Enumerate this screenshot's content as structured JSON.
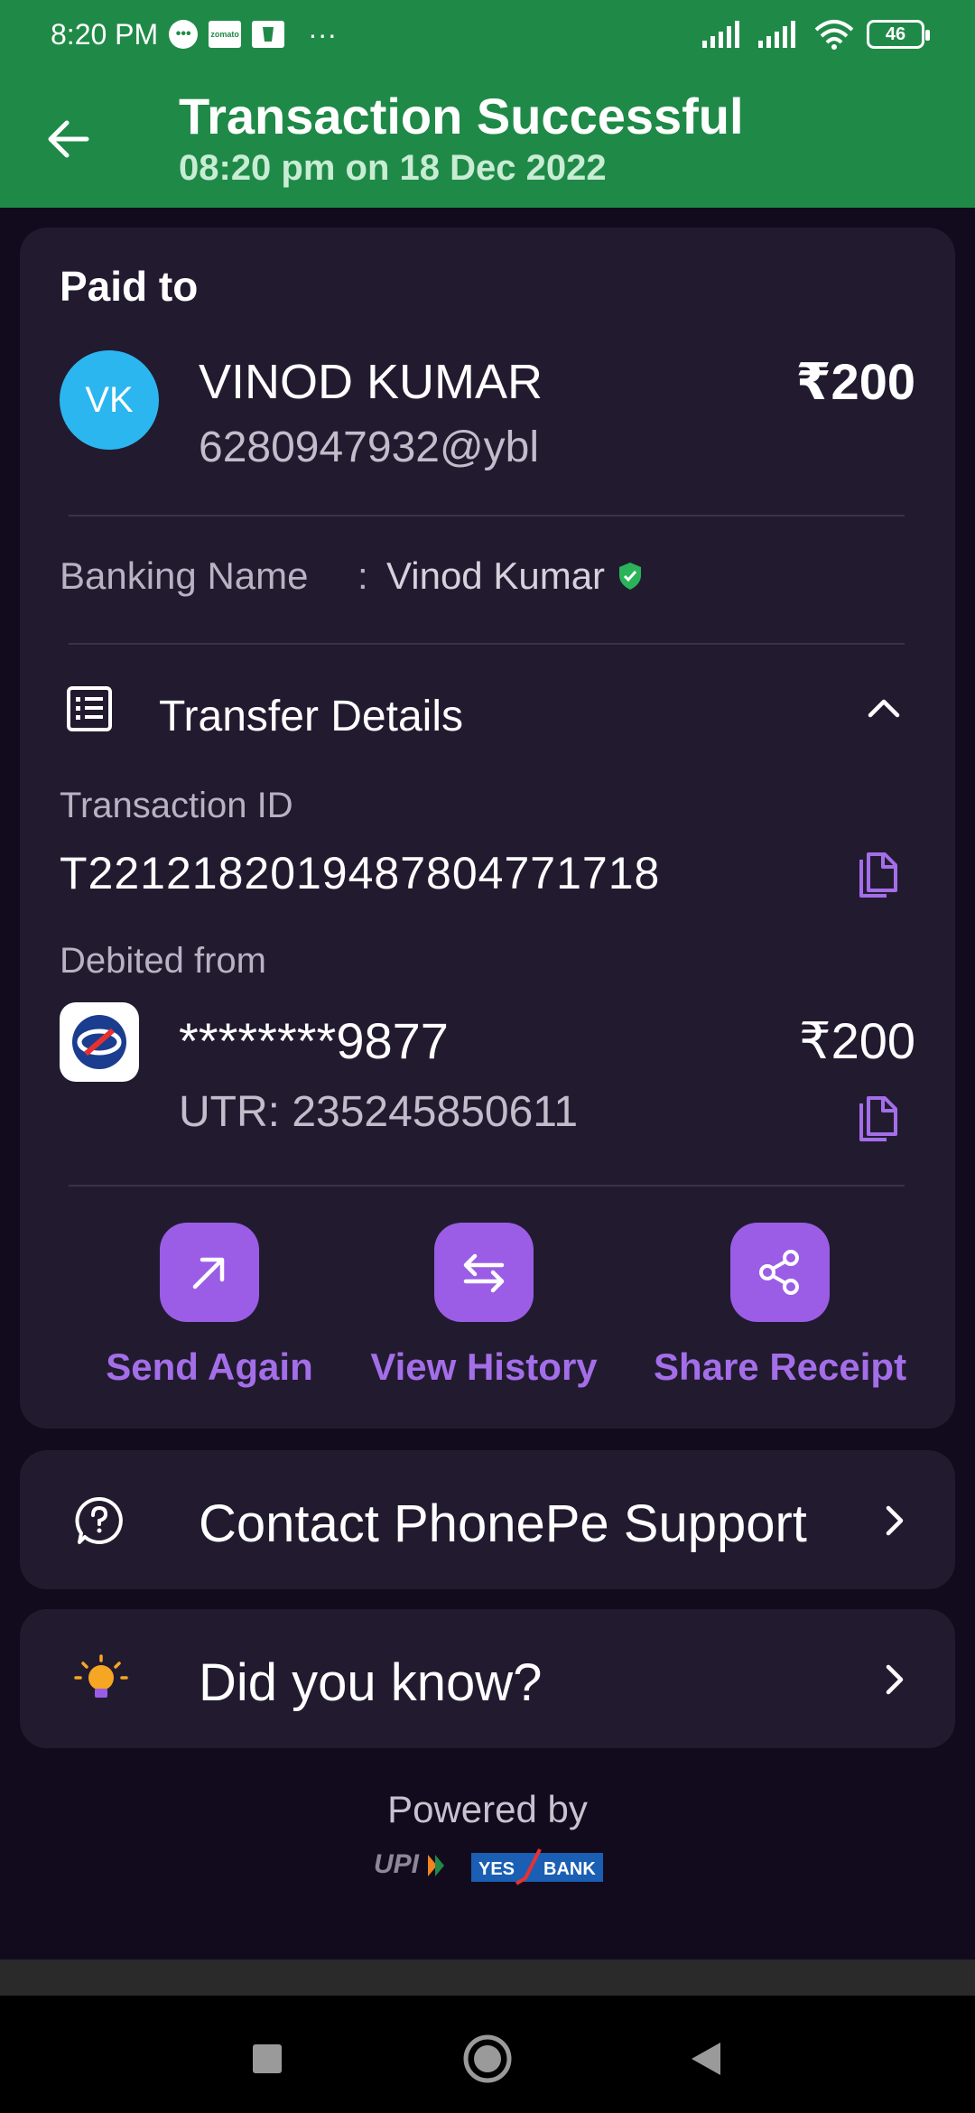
{
  "status_bar": {
    "time": "8:20 PM",
    "notifications": [
      "chat-bubble-icon",
      "zomato-icon",
      "swiggy-icon"
    ],
    "zomato_label": "zomato",
    "more": "···",
    "battery": "46"
  },
  "header": {
    "title": "Transaction Successful",
    "subtitle": "08:20 pm on 18 Dec 2022",
    "bg_color": "#1f8a47"
  },
  "payment": {
    "section_label": "Paid to",
    "avatar_initials": "VK",
    "avatar_color": "#2cb6f0",
    "payee_name": "VINOD KUMAR",
    "payee_upi": "6280947932@ybl",
    "amount": "₹200",
    "banking_name_label": "Banking Name",
    "banking_name_colon": ":",
    "banking_name_value": "Vinod Kumar"
  },
  "transfer": {
    "title": "Transfer Details",
    "transaction_id_label": "Transaction ID",
    "transaction_id": "T2212182019487804771718",
    "debited_from_label": "Debited from",
    "account": "********9877",
    "utr": "UTR: 235245850611",
    "amount": "₹200"
  },
  "actions": [
    {
      "label": "Send Again",
      "icon": "arrow-up-right-icon"
    },
    {
      "label": "View History",
      "icon": "swap-arrows-icon"
    },
    {
      "label": "Share Receipt",
      "icon": "share-icon"
    }
  ],
  "support": {
    "label": "Contact PhonePe Support",
    "icon": "help-circle-icon"
  },
  "did_you_know": {
    "label": "Did you know?",
    "icon": "lightbulb-icon"
  },
  "footer": {
    "powered_by": "Powered by",
    "upi_logo_text": "UPI",
    "bank_logo_text": "YES BANK"
  },
  "colors": {
    "accent": "#9b5de5",
    "card_bg": "#221b30",
    "page_bg": "#120b1d"
  }
}
